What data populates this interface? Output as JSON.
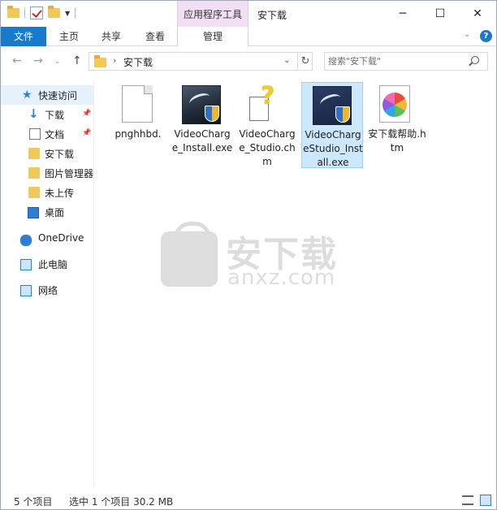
{
  "window": {
    "title": "安下载",
    "context_tab_group": "应用程序工具",
    "minimize": "─",
    "maximize": "☐",
    "close": "✕"
  },
  "ribbon": {
    "tabs": [
      {
        "label": "文件"
      },
      {
        "label": "主页"
      },
      {
        "label": "共享"
      },
      {
        "label": "查看"
      },
      {
        "label": "管理"
      }
    ],
    "toggle": "⌄",
    "help": "?"
  },
  "address": {
    "path": "安下载",
    "chevron": "›",
    "dropdown": "⌄",
    "refresh": "↻",
    "back": "←",
    "forward": "→",
    "recent": "⌄",
    "up": "↑"
  },
  "search": {
    "placeholder": "搜索\"安下载\""
  },
  "nav": {
    "quick_access": "快速访问",
    "items": [
      {
        "label": "下载",
        "pinned": true
      },
      {
        "label": "文档",
        "pinned": true
      },
      {
        "label": "安下载"
      },
      {
        "label": "图片管理器"
      },
      {
        "label": "未上传"
      },
      {
        "label": "桌面"
      }
    ],
    "onedrive": "OneDrive",
    "this_pc": "此电脑",
    "network": "网络",
    "pin_glyph": "📌"
  },
  "files": [
    {
      "name": "pnghhbd.",
      "icon": "blank-file-icon"
    },
    {
      "name": "VideoCharge_Install.exe",
      "icon": "installer-icon"
    },
    {
      "name": "VideoCharge_Studio.chm",
      "icon": "chm-help-icon"
    },
    {
      "name": "VideoChargeStudio_Install.exe",
      "icon": "installer-icon",
      "selected": true
    },
    {
      "name": "安下载帮助.htm",
      "icon": "htm-file-icon"
    }
  ],
  "watermark": {
    "cn": "安下载",
    "en": "anxz.com"
  },
  "status": {
    "count": "5 个项目",
    "selection": "选中 1 个项目  30.2 MB"
  },
  "colors": {
    "accent": "#1979ca",
    "selection": "#cce8ff",
    "context_tab": "#f2dff5"
  }
}
